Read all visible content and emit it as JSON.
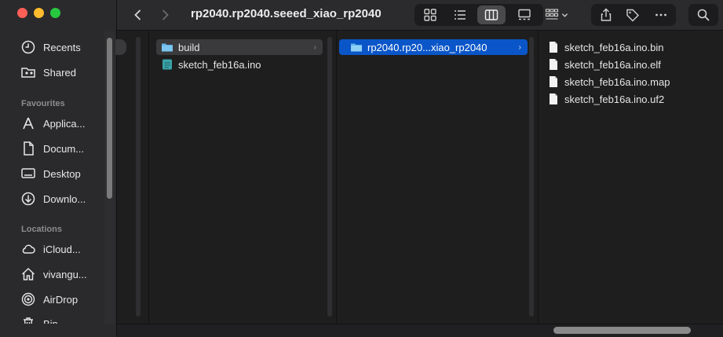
{
  "window": {
    "title": "rp2040.rp2040.seeed_xiao_rp2040"
  },
  "sidebar": {
    "sections": [
      {
        "label": ""
      },
      {
        "label": "Favourites"
      },
      {
        "label": "Locations"
      }
    ],
    "items": [
      {
        "label": "Recents",
        "icon": "clock-icon"
      },
      {
        "label": "Shared",
        "icon": "shared-folder-icon"
      },
      {
        "label": "Applica...",
        "icon": "applications-icon"
      },
      {
        "label": "Docum...",
        "icon": "document-icon"
      },
      {
        "label": "Desktop",
        "icon": "desktop-icon"
      },
      {
        "label": "Downlo...",
        "icon": "download-icon"
      },
      {
        "label": "iCloud...",
        "icon": "cloud-icon"
      },
      {
        "label": "vivangu...",
        "icon": "home-icon"
      },
      {
        "label": "AirDrop",
        "icon": "airdrop-icon"
      },
      {
        "label": "Bin",
        "icon": "trash-icon"
      }
    ]
  },
  "columns": {
    "col1": [
      {
        "label": "build",
        "type": "folder",
        "selected": true
      },
      {
        "label": "sketch_feb16a.ino",
        "type": "ino-file",
        "selected": false
      }
    ],
    "col2": [
      {
        "label": "rp2040.rp20...xiao_rp2040",
        "type": "folder",
        "selected": true
      }
    ],
    "col3": [
      {
        "label": "sketch_feb16a.ino.bin",
        "type": "file"
      },
      {
        "label": "sketch_feb16a.ino.elf",
        "type": "file"
      },
      {
        "label": "sketch_feb16a.ino.map",
        "type": "file"
      },
      {
        "label": "sketch_feb16a.ino.uf2",
        "type": "file"
      }
    ]
  },
  "colors": {
    "selection": "#0a56c8",
    "folder": "#5fb4e8",
    "background": "#1e1e1e",
    "sidebar": "#2a2a2c"
  }
}
